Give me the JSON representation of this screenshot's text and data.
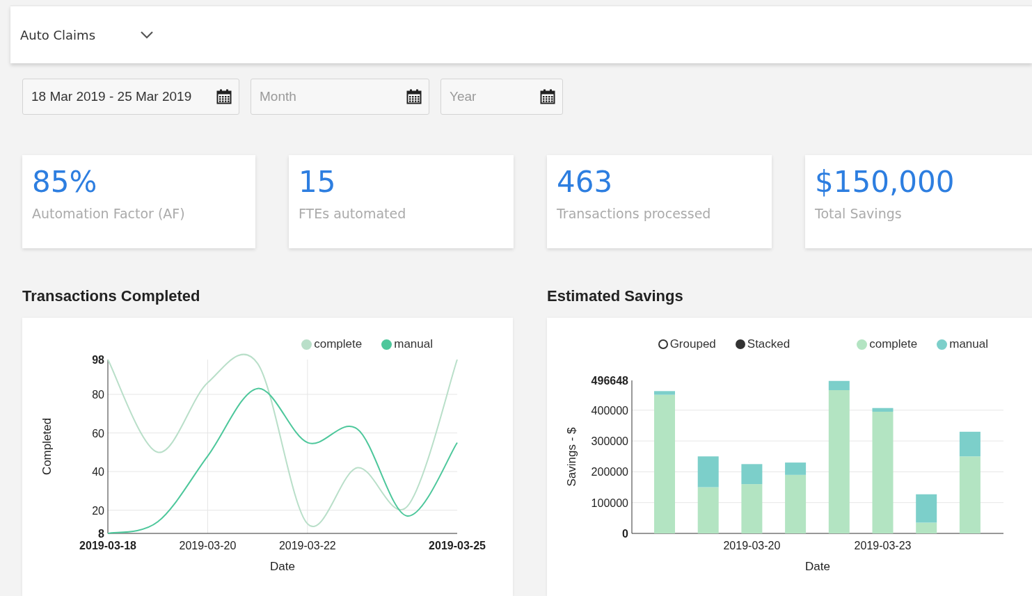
{
  "header": {
    "selector": {
      "value": "Auto Claims"
    }
  },
  "filters": [
    {
      "value": "18 Mar 2019 - 25 Mar 2019"
    },
    {
      "placeholder": "Month"
    },
    {
      "placeholder": "Year"
    }
  ],
  "kpis": [
    {
      "value": "85%",
      "label": "Automation Factor (AF)"
    },
    {
      "value": "15",
      "label": "FTEs automated"
    },
    {
      "value": "463",
      "label": "Transactions processed"
    },
    {
      "value": "$150,000",
      "label": "Total Savings"
    }
  ],
  "charts": [
    {
      "title": "Transactions Completed",
      "chart_data": {
        "type": "line",
        "grid": true,
        "xlabel": "Date",
        "ylabel": "Completed",
        "categories": [
          "2019-03-18",
          null,
          "2019-03-20",
          null,
          "2019-03-22",
          null,
          null,
          "2019-03-25"
        ],
        "series": [
          {
            "name": "complete",
            "color": "#b9dfc9",
            "values": [
              98,
              50,
              86,
              96,
              13,
              42,
              22,
              98
            ]
          },
          {
            "name": "manual",
            "color": "#4dc79b",
            "values": [
              8,
              14,
              48,
              83,
              55,
              62,
              17,
              55
            ]
          }
        ],
        "ylim": [
          8,
          98
        ],
        "yticks": [
          8,
          20,
          40,
          60,
          80,
          98
        ]
      }
    },
    {
      "title": "Estimated Savings",
      "modes": [
        {
          "label": "Grouped",
          "selected": false
        },
        {
          "label": "Stacked",
          "selected": true
        }
      ],
      "chart_data": {
        "type": "bar",
        "grid": true,
        "stacked": true,
        "xlabel": "Date",
        "ylabel": "Savings - $",
        "categories": [
          null,
          null,
          "2019-03-20",
          null,
          null,
          "2019-03-23",
          null,
          null
        ],
        "series": [
          {
            "name": "complete",
            "color": "#b3e4c2",
            "values": [
              450000,
              150000,
              160000,
              190000,
              465000,
              395000,
              35000,
              250000
            ]
          },
          {
            "name": "manual",
            "color": "#7ccfca",
            "values": [
              12000,
              100000,
              65000,
              40000,
              30000,
              12000,
              92000,
              80000
            ]
          }
        ],
        "ylim": [
          0,
          496648
        ],
        "yticks": [
          0,
          100000,
          200000,
          300000,
          400000,
          496648
        ]
      }
    }
  ]
}
